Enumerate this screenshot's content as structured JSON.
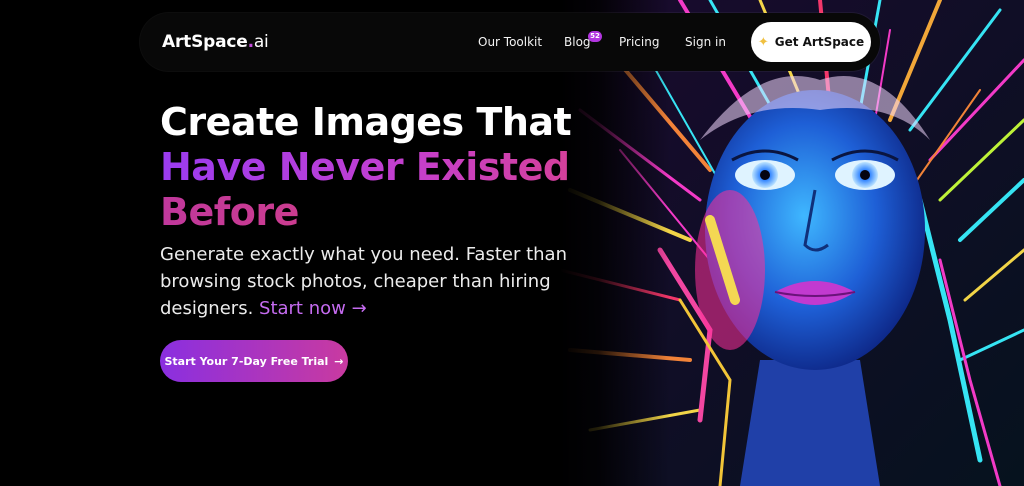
{
  "brand": {
    "name": "ArtSpace",
    "dot": ".",
    "suffix": "ai"
  },
  "nav": {
    "toolkit": "Our Toolkit",
    "blog": "Blog",
    "blog_badge": "52",
    "pricing": "Pricing",
    "signin": "Sign in",
    "cta": "Get ArtSpace",
    "cta_icon": "sparkle-icon"
  },
  "hero": {
    "headline_line1": "Create Images That",
    "headline_line2": "Have Never Existed",
    "headline_line3": "Before",
    "subtext": "Generate exactly what you need. Faster than browsing stock photos, cheaper than hiring designers. ",
    "start_now": "Start now →",
    "cta_label": "Start Your 7-Day Free Trial",
    "cta_arrow": "→",
    "image_subject": "neon portrait of a woman with colorful light-streaked hair"
  },
  "colors": {
    "background": "#000000",
    "accent_purple": "#9b3cf0",
    "accent_pink": "#e24478",
    "link": "#c56bf0"
  }
}
